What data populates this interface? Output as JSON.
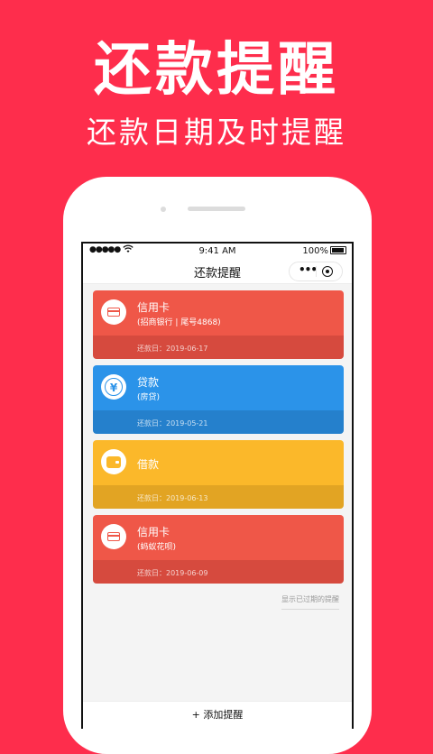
{
  "promo": {
    "headline": "还款提醒",
    "subline": "还款日期及时提醒"
  },
  "statusbar": {
    "signal": "●●●●●",
    "time": "9:41 AM",
    "battery": "100%"
  },
  "navbar": {
    "title": "还款提醒"
  },
  "reminders": [
    {
      "name": "信用卡",
      "sub": "(招商银行 | 尾号4868)",
      "due": "还款日：2019-06-17",
      "icon": "credit-card-icon",
      "color": "#ef5748",
      "color_dark": "#d64a3e"
    },
    {
      "name": "贷款",
      "sub": "(房贷)",
      "due": "还款日：2019-05-21",
      "icon": "yen-coin-icon",
      "color": "#2b93e9",
      "color_dark": "#2580cc"
    },
    {
      "name": "借款",
      "sub": "",
      "due": "还款日：2019-06-13",
      "icon": "wallet-icon",
      "color": "#fbb82a",
      "color_dark": "#e2a423"
    },
    {
      "name": "信用卡",
      "sub": "(蚂蚁花呗)",
      "due": "还款日：2019-06-09",
      "icon": "credit-card-icon",
      "color": "#ef5748",
      "color_dark": "#d64a3e"
    }
  ],
  "show_expired": "显示已过期的提醒",
  "footer": {
    "add_label": "+ 添加提醒"
  }
}
